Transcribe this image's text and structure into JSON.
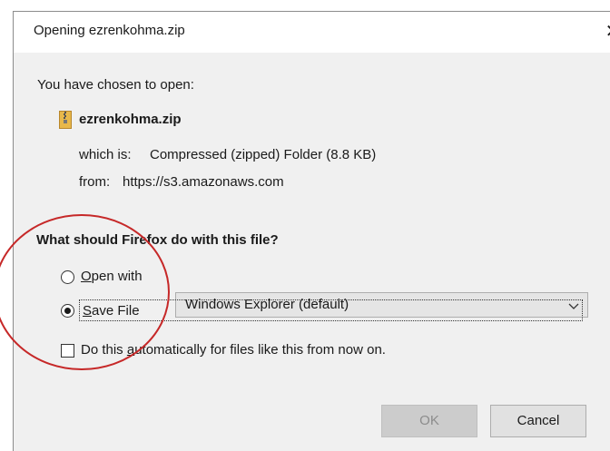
{
  "dialog": {
    "title": "Opening ezrenkohma.zip",
    "close_glyph": "✕"
  },
  "content": {
    "intro": "You have chosen to open:",
    "file_icon": "zip-file-icon",
    "filename": "ezrenkohma.zip",
    "which_label": "which is:",
    "which_value": "Compressed (zipped) Folder (8.8 KB)",
    "from_label": "from:",
    "from_value": "https://s3.amazonaws.com",
    "question": "What should Firefox do with this file?"
  },
  "options": {
    "open_with": {
      "accesskey": "O",
      "label_rest": "pen with",
      "selected": false
    },
    "handler_select": {
      "value": "Windows Explorer (default)"
    },
    "save_file": {
      "accesskey": "S",
      "label_rest": "ave File",
      "selected": true
    },
    "auto": {
      "label_before": "Do this ",
      "accesskey": "a",
      "label_after": "utomatically for files like this from now on.",
      "checked": false
    }
  },
  "buttons": {
    "ok": "OK",
    "cancel": "Cancel"
  },
  "colors": {
    "annotation_circle": "#c62828",
    "dialog_bg": "#f0f0f0",
    "zip_icon": "#e8b84a"
  }
}
